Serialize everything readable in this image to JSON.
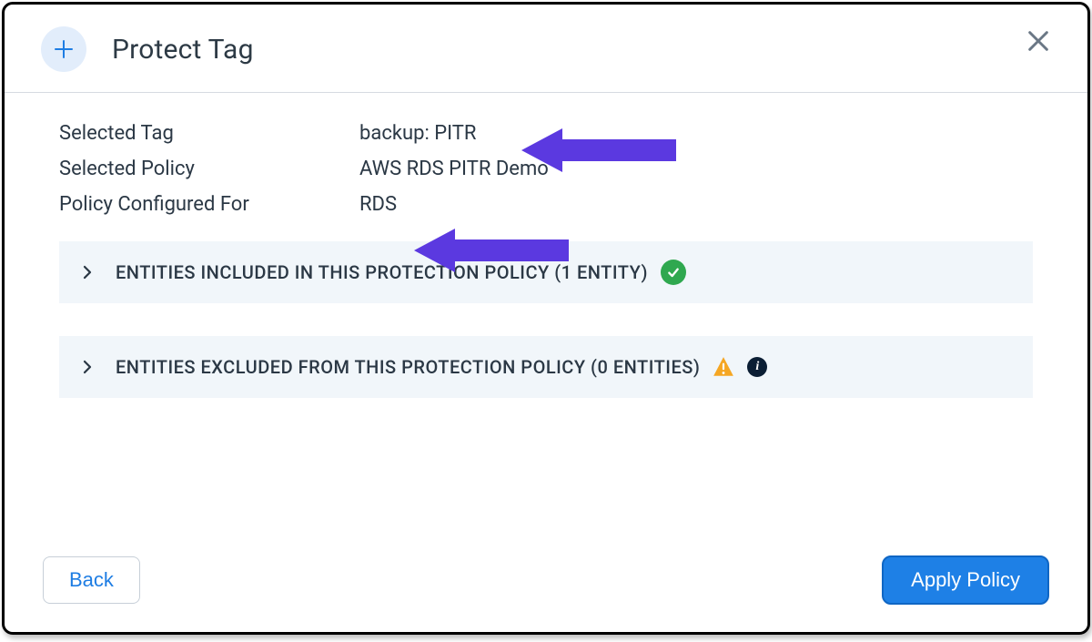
{
  "header": {
    "title": "Protect Tag"
  },
  "info": {
    "selected_tag_label": "Selected Tag",
    "selected_tag_value": "backup: PITR",
    "selected_policy_label": "Selected Policy",
    "selected_policy_value": "AWS RDS PITR Demo",
    "policy_configured_label": "Policy Configured For",
    "policy_configured_value": "RDS"
  },
  "panels": {
    "included_label": "ENTITIES INCLUDED IN THIS PROTECTION POLICY  (1 ENTITY)",
    "excluded_label": "ENTITIES EXCLUDED FROM THIS PROTECTION POLICY  (0 ENTITIES)"
  },
  "footer": {
    "back_label": "Back",
    "apply_label": "Apply Policy"
  },
  "annotations": {
    "arrow_color": "#5b39e0"
  }
}
